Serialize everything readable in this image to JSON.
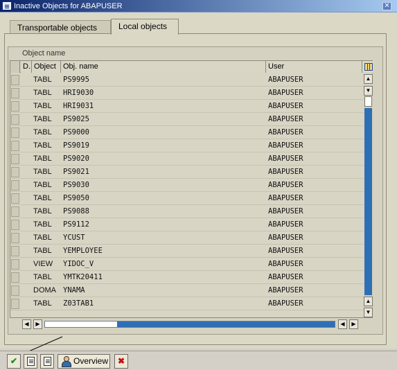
{
  "window": {
    "title": "Inactive Objects for ABAPUSER",
    "close_glyph": "✕"
  },
  "tabs": [
    {
      "label": "Transportable objects",
      "active": false
    },
    {
      "label": "Local objects",
      "active": true
    }
  ],
  "group": {
    "title": "Object name"
  },
  "table": {
    "headers": {
      "d": "D.",
      "object": "Object",
      "obj_name": "Obj. name",
      "user": "User"
    },
    "rows": [
      {
        "object": "TABL",
        "name": "PS9995",
        "user": "ABAPUSER"
      },
      {
        "object": "TABL",
        "name": "HRI9030",
        "user": "ABAPUSER"
      },
      {
        "object": "TABL",
        "name": "HRI9031",
        "user": "ABAPUSER"
      },
      {
        "object": "TABL",
        "name": "PS9025",
        "user": "ABAPUSER"
      },
      {
        "object": "TABL",
        "name": "PS9000",
        "user": "ABAPUSER"
      },
      {
        "object": "TABL",
        "name": "PS9019",
        "user": "ABAPUSER"
      },
      {
        "object": "TABL",
        "name": "PS9020",
        "user": "ABAPUSER"
      },
      {
        "object": "TABL",
        "name": "PS9021",
        "user": "ABAPUSER"
      },
      {
        "object": "TABL",
        "name": "PS9030",
        "user": "ABAPUSER"
      },
      {
        "object": "TABL",
        "name": "PS9050",
        "user": "ABAPUSER"
      },
      {
        "object": "TABL",
        "name": "PS9088",
        "user": "ABAPUSER"
      },
      {
        "object": "TABL",
        "name": "PS9112",
        "user": "ABAPUSER"
      },
      {
        "object": "TABL",
        "name": "YCUST",
        "user": "ABAPUSER"
      },
      {
        "object": "TABL",
        "name": "YEMPLOYEE",
        "user": "ABAPUSER"
      },
      {
        "object": "VIEW",
        "name": "YIDOC_V",
        "user": "ABAPUSER"
      },
      {
        "object": "TABL",
        "name": "YMTK20411",
        "user": "ABAPUSER"
      },
      {
        "object": "DOMA",
        "name": "YNAMA",
        "user": "ABAPUSER"
      },
      {
        "object": "TABL",
        "name": "Z03TAB1",
        "user": "ABAPUSER"
      }
    ]
  },
  "toolbar": {
    "overview_label": "Overview",
    "check_glyph": "✔",
    "cancel_glyph": "✖"
  },
  "colors": {
    "titlebar_start": "#0a246a",
    "scroll_track": "#2c6fb5"
  }
}
